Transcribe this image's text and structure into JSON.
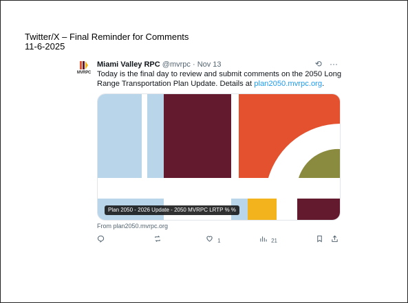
{
  "slide": {
    "title": "Twitter/X – Final Reminder for Comments",
    "date": "11-6-2025"
  },
  "tweet": {
    "avatar_text": "MVRPC",
    "name": "Miami Valley RPC",
    "handle": "@mvrpc",
    "separator": " · ",
    "time": "Nov 13",
    "more_glyph": "···",
    "grok_glyph": "⟲",
    "body_text": "Today is the final day to review and submit comments on the 2050 Long Range Transportation Plan Update. Details at ",
    "body_link": "plan2050.mvrpc.org",
    "body_end": ".",
    "media_caption": "Plan 2050 - 2026 Update - 2050 MVRPC LRTP % %",
    "from": "From plan2050.mvrpc.org",
    "actions": {
      "reply_count": "",
      "repost_count": "",
      "like_count": "1",
      "views_count": "21"
    }
  },
  "colors": {
    "light_blue": "#b9d5ea",
    "maroon": "#641a2e",
    "orange_red": "#e4512f",
    "olive": "#8a8b3f",
    "yellow": "#f2b31c",
    "link": "#1d9bf0"
  }
}
